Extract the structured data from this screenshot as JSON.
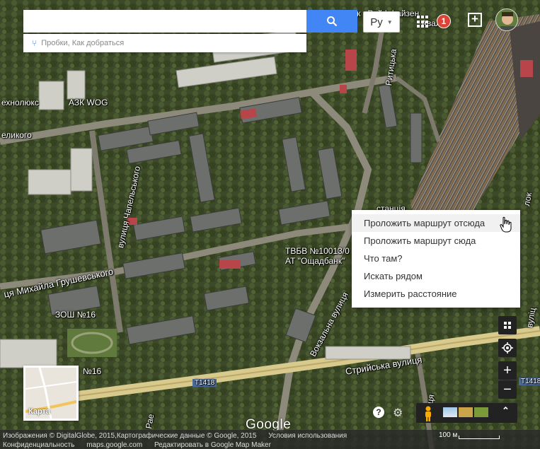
{
  "search": {
    "value": "",
    "placeholder": "",
    "suggestion": "Пробки, Как добраться"
  },
  "header": {
    "language": "Ру",
    "notifications": "1",
    "top_label_1": "Банк «Райффайзен",
    "top_label_2": "Авал»"
  },
  "map_labels": {
    "tehnolux": "ехнолюкс",
    "azk_wog": "АЗК WOG",
    "velykogo": "еликого",
    "chapelskogo": "вулиця Чапельського",
    "hrushevskogo": "ця Михайла Грушевського",
    "rytytska": "Ритицька",
    "stantsia": "станція",
    "tvbv": "ТВБВ №10013/0",
    "oshchadbank": "АТ \"Ощадбанк\"",
    "zosh": "ЗОШ №16",
    "n16": "№16",
    "vokzalna": "Вокзальна вулиця",
    "stryiska": "Стрийська вулиця",
    "road_t1418_a": "Т1418",
    "road_t1418_b": "Т1418",
    "vulytsia_right": "вулиця",
    "vulytsia_right2": "вуліц",
    "rae": "Рае",
    "lok": "лок"
  },
  "context_menu": {
    "items": [
      {
        "label": "Проложить маршрут отсюда",
        "hover": true
      },
      {
        "label": "Проложить маршрут сюда",
        "hover": false
      },
      {
        "label": "Что там?",
        "hover": false
      },
      {
        "label": "Искать рядом",
        "hover": false
      },
      {
        "label": "Измерить расстояние",
        "hover": false
      }
    ]
  },
  "minimap": {
    "label": "Карта"
  },
  "logo": "Google",
  "footer": {
    "imagery": "Изображения © DigitalGlobe, 2015,Картографические данные © Google, 2015",
    "terms": "Условия использования",
    "privacy": "Конфиденциальность",
    "site": "maps.google.com",
    "edit": "Редактировать в Google Map Maker",
    "scale": "100 м"
  },
  "icons": {
    "search": "search-icon",
    "apps": "apps-grid-icon",
    "add": "add-box-icon",
    "layers": "layers-icon",
    "location": "my-location-icon",
    "pegman": "pegman-icon",
    "help": "help-icon",
    "settings": "gear-icon"
  },
  "colors": {
    "search_button": "#4285f4",
    "badge": "#db4437",
    "road": "#d8c98c"
  }
}
